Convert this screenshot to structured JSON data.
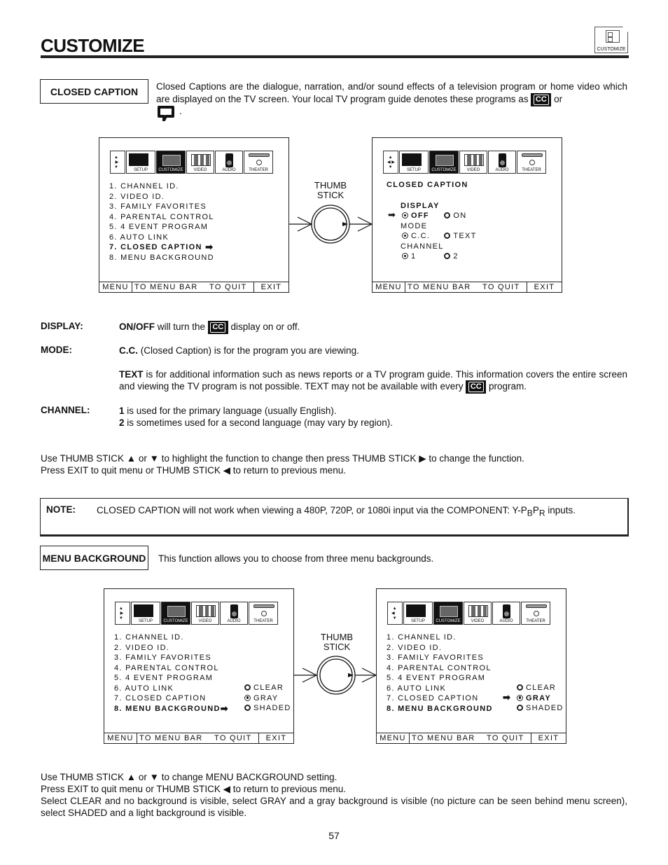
{
  "header": {
    "title": "CUSTOMIZE",
    "corner_icon_label": "CUSTOMIZE"
  },
  "closed_caption": {
    "label": "CLOSED CAPTION",
    "intro_part1": "Closed Captions are the dialogue, narration, and/or sound effects of a television program or home video which are displayed on the TV screen.  Your local TV program guide denotes these programs as",
    "intro_or": "or",
    "intro_end": ".",
    "cc_symbol": "CC"
  },
  "menu_tabs": [
    "SETUP",
    "CUSTOMIZE",
    "VIDEO",
    "AUDIO",
    "THEATER"
  ],
  "menu_items": [
    "1. CHANNEL ID.",
    "2. VIDEO ID.",
    "3. FAMILY FAVORITES",
    "4. PARENTAL CONTROL",
    "5. 4 EVENT PROGRAM",
    "6. AUTO LINK",
    "7. CLOSED CAPTION",
    "8. MENU BACKGROUND"
  ],
  "bottom_bar": {
    "menu": "MENU",
    "to_menu_bar": "TO MENU BAR",
    "to_quit": "TO QUIT",
    "exit": "EXIT"
  },
  "thumb_stick": {
    "line1": "THUMB",
    "line2": "STICK"
  },
  "cc_screen": {
    "heading": "CLOSED CAPTION",
    "display_label": "DISPLAY",
    "display_options": [
      {
        "label": "OFF",
        "selected": true
      },
      {
        "label": "ON",
        "selected": false
      }
    ],
    "mode_label": "MODE",
    "mode_options": [
      {
        "label": "C.C.",
        "selected": true
      },
      {
        "label": "TEXT",
        "selected": false
      }
    ],
    "channel_label": "CHANNEL",
    "channel_options": [
      {
        "label": "1",
        "selected": true
      },
      {
        "label": "2",
        "selected": false
      }
    ]
  },
  "definitions": {
    "display_term": "DISPLAY:",
    "display_bold": "ON/OFF",
    "display_text1": " will turn the ",
    "display_text2": " display on or off.",
    "mode_term": "MODE:",
    "mode_cc_bold": "C.C.",
    "mode_cc_text": " (Closed Caption) is for the program you are viewing.",
    "mode_text_bold": "TEXT",
    "mode_text_text": " is for additional information such as news reports or a TV program guide.  This information covers the entire screen and viewing the TV program is not possible.  TEXT may not be available with every ",
    "mode_text_end": " program.",
    "channel_term": "CHANNEL:",
    "channel1_bold": "1",
    "channel1_text": " is used for the primary language (usually English).",
    "channel2_bold": "2",
    "channel2_text": " is sometimes used for a second language (may vary by region)."
  },
  "instructions_cc": {
    "line1": "Use THUMB STICK ▲ or ▼ to highlight the function to change then press THUMB STICK ▶ to change the function.",
    "line2": "Press EXIT to quit menu or THUMB STICK ◀ to return to previous menu."
  },
  "note": {
    "label": "NOTE:",
    "text_main": "CLOSED CAPTION will not work when viewing a 480P, 720P, or 1080i input via the COMPONENT: Y-P",
    "sub_b": "B",
    "p": "P",
    "sub_r": "R",
    "text_end": " inputs."
  },
  "menu_background": {
    "label": "MENU BACKGROUND",
    "description": "This function allows you to choose from three menu backgrounds.",
    "options": [
      {
        "label": "CLEAR",
        "selected": false
      },
      {
        "label": "GRAY",
        "selected": true
      },
      {
        "label": "SHADED",
        "selected": false
      }
    ]
  },
  "instructions_mb": {
    "line1": "Use THUMB STICK ▲ or ▼ to change MENU BACKGROUND setting.",
    "line2": "Press EXIT to quit menu or THUMB STICK ◀ to return to previous menu.",
    "line3": "Select CLEAR and no background is visible, select GRAY and a gray background is visible (no picture can be seen behind menu screen), select SHADED and a light background is visible."
  },
  "page_number": "57"
}
